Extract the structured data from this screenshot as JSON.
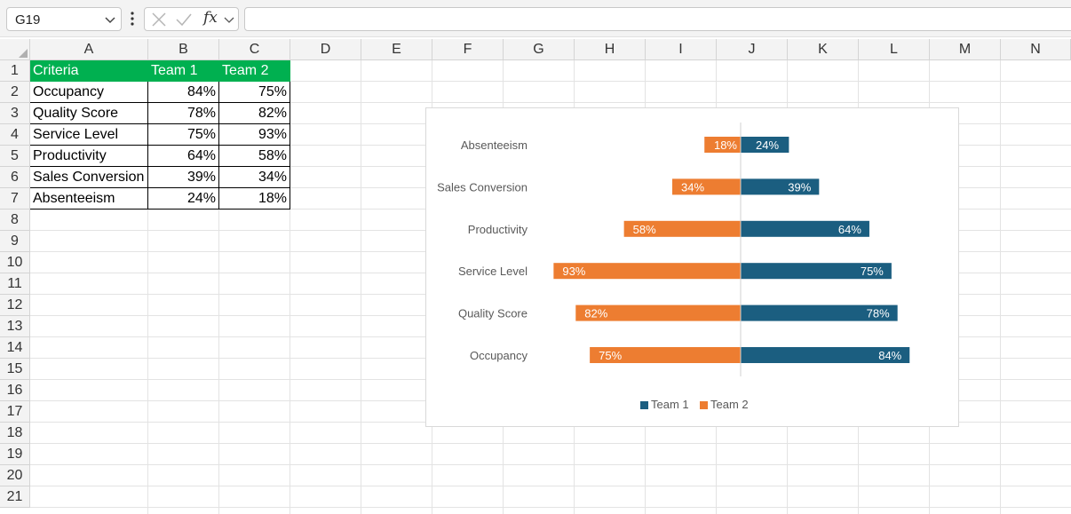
{
  "name_box": {
    "value": "G19"
  },
  "formula_bar": {
    "fx_label": "fx",
    "value": ""
  },
  "columns": [
    "A",
    "B",
    "C",
    "D",
    "E",
    "F",
    "G",
    "H",
    "I",
    "J",
    "K",
    "L",
    "M",
    "N"
  ],
  "rows": [
    "1",
    "2",
    "3",
    "4",
    "5",
    "6",
    "7",
    "8",
    "9",
    "10",
    "11",
    "12",
    "13",
    "14",
    "15",
    "16",
    "17",
    "18",
    "19",
    "20",
    "21"
  ],
  "table": {
    "headers": [
      "Criteria",
      "Team 1",
      "Team 2"
    ],
    "header_color": "#00b050",
    "rows": [
      [
        "Occupancy",
        "84%",
        "75%"
      ],
      [
        "Quality Score",
        "78%",
        "82%"
      ],
      [
        "Service Level",
        "75%",
        "93%"
      ],
      [
        "Productivity",
        "64%",
        "58%"
      ],
      [
        "Sales Conversion",
        "39%",
        "34%"
      ],
      [
        "Absenteeism",
        "24%",
        "18%"
      ]
    ]
  },
  "chart_data": {
    "type": "bar",
    "orientation": "horizontal-diverging",
    "categories": [
      "Absenteeism",
      "Sales Conversion",
      "Productivity",
      "Service Level",
      "Quality Score",
      "Occupancy"
    ],
    "series": [
      {
        "name": "Team 1",
        "color": "#1b5e80",
        "side": "right",
        "values": [
          24,
          39,
          64,
          75,
          78,
          84
        ],
        "labels": [
          "24%",
          "39%",
          "64%",
          "75%",
          "78%",
          "84%"
        ]
      },
      {
        "name": "Team 2",
        "color": "#ed7d31",
        "side": "left",
        "values": [
          18,
          34,
          58,
          93,
          82,
          75
        ],
        "labels": [
          "18%",
          "34%",
          "58%",
          "93%",
          "82%",
          "75%"
        ]
      }
    ],
    "xlim": [
      -100,
      100
    ],
    "legend_position": "bottom",
    "grid": false
  }
}
